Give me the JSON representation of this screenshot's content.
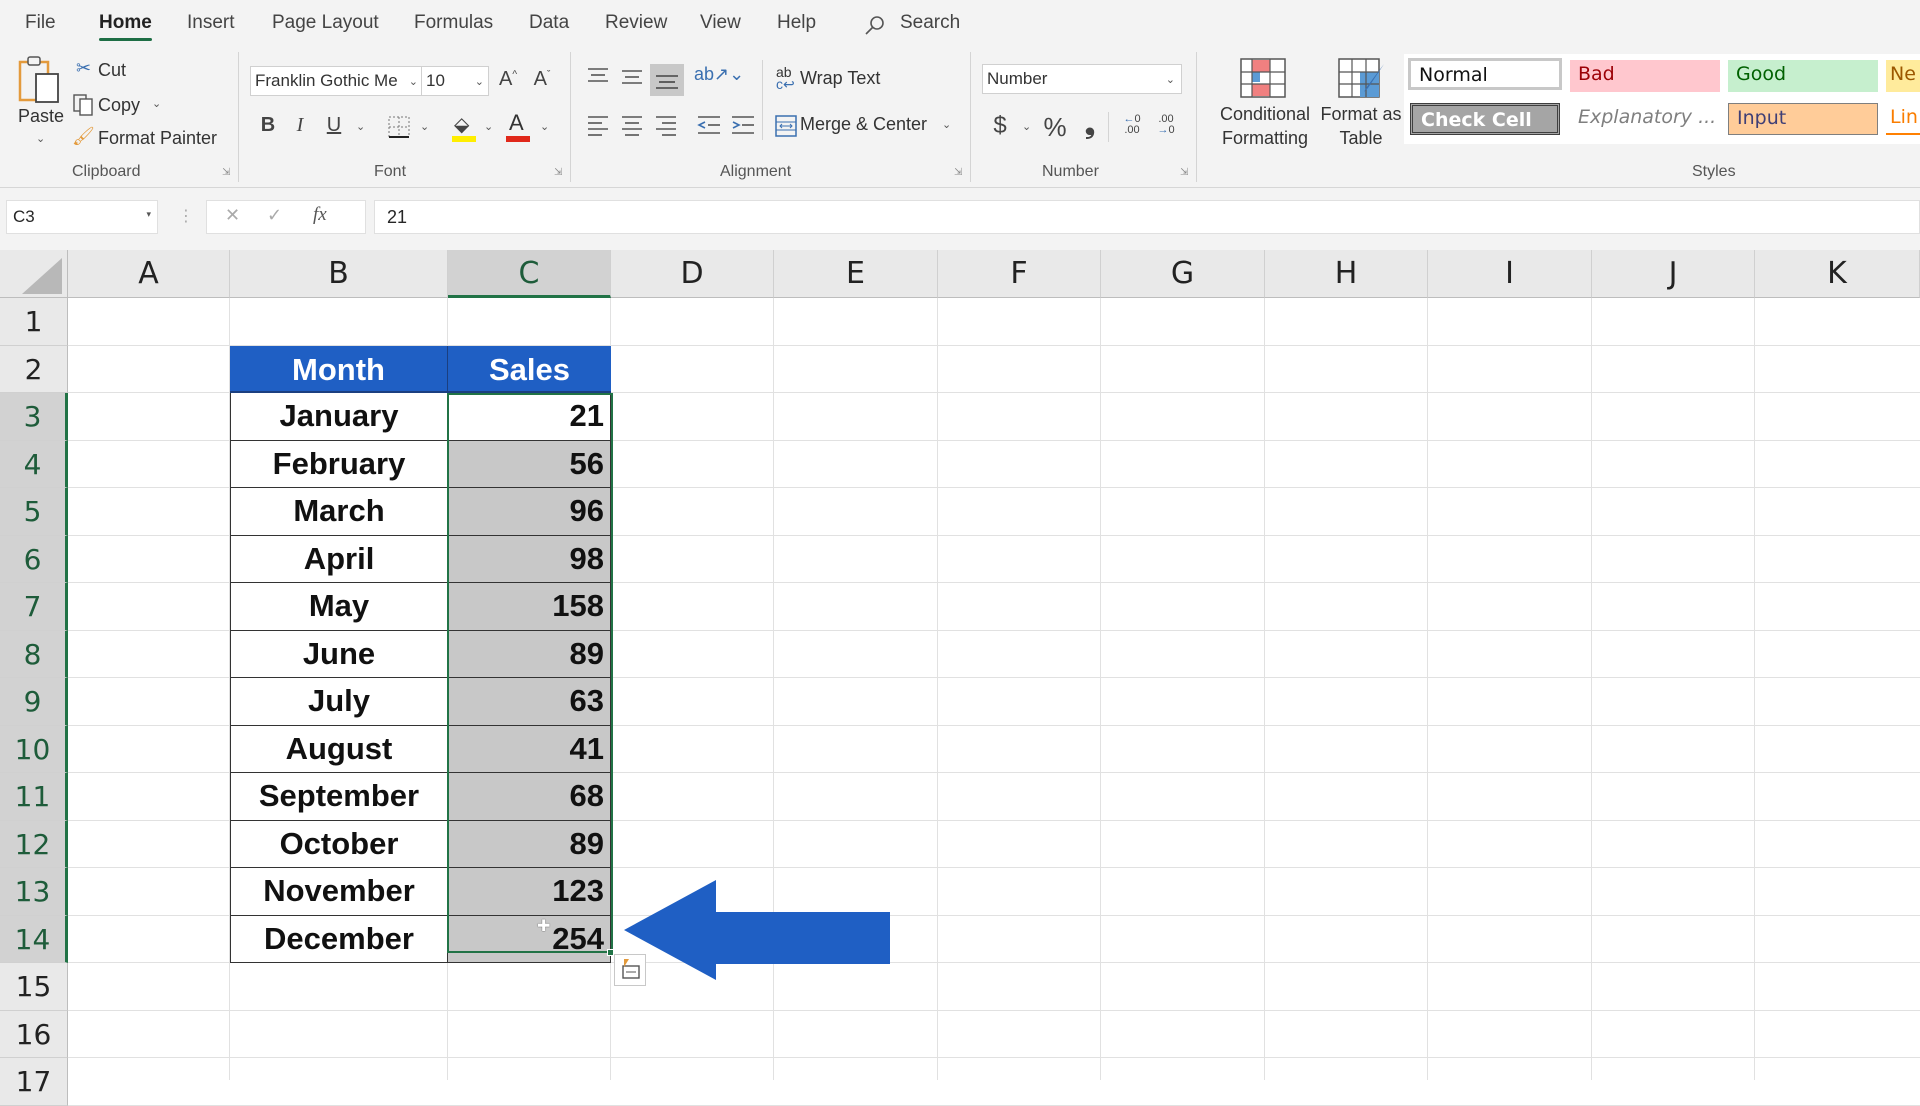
{
  "ribbon": {
    "tabs": [
      {
        "label": "File",
        "active": false
      },
      {
        "label": "Home",
        "active": true
      },
      {
        "label": "Insert",
        "active": false
      },
      {
        "label": "Page Layout",
        "active": false
      },
      {
        "label": "Formulas",
        "active": false
      },
      {
        "label": "Data",
        "active": false
      },
      {
        "label": "Review",
        "active": false
      },
      {
        "label": "View",
        "active": false
      },
      {
        "label": "Help",
        "active": false
      }
    ],
    "search_label": "Search",
    "clipboard": {
      "group_label": "Clipboard",
      "paste": "Paste",
      "cut": "Cut",
      "copy": "Copy",
      "format_painter": "Format Painter"
    },
    "font": {
      "group_label": "Font",
      "font_name": "Franklin Gothic Me",
      "font_size": "10",
      "bold": "B",
      "italic": "I",
      "underline": "U",
      "font_color_glyph": "A",
      "fill_color": "#ffee00",
      "font_color": "#e0281a"
    },
    "alignment": {
      "group_label": "Alignment",
      "wrap_text": "Wrap Text",
      "merge_center": "Merge & Center"
    },
    "number": {
      "group_label": "Number",
      "format": "Number",
      "currency": "$",
      "percent": "%",
      "comma": "9",
      "inc_decimal": "←0 .00",
      "dec_decimal": ".00 →0"
    },
    "styles": {
      "group_label": "Styles",
      "conditional_formatting": [
        "Conditional",
        "Formatting"
      ],
      "format_as_table": [
        "Format as",
        "Table"
      ],
      "cell_styles": [
        {
          "label": "Normal",
          "bg": "#ffffff",
          "fg": "#111111"
        },
        {
          "label": "Bad",
          "bg": "#ffc7ce",
          "fg": "#9c0006"
        },
        {
          "label": "Good",
          "bg": "#c6efce",
          "fg": "#006100"
        },
        {
          "label": "Ne",
          "bg": "#ffeb9c",
          "fg": "#9c5700"
        },
        {
          "label": "Check Cell",
          "bg": "#a5a5a5",
          "fg": "#ffffff"
        },
        {
          "label": "Explanatory ...",
          "bg": "#ffffff",
          "fg": "#7f7f7f"
        },
        {
          "label": "Input",
          "bg": "#ffcc99",
          "fg": "#3f3f76"
        },
        {
          "label": "Lin",
          "bg": "#ffffff",
          "fg": "#fa7d00"
        }
      ]
    }
  },
  "formula_bar": {
    "name_box": "C3",
    "cancel": "✕",
    "enter": "✓",
    "fx": "fx",
    "formula": "21"
  },
  "sheet": {
    "columns": [
      "A",
      "B",
      "C",
      "D",
      "E",
      "F",
      "G",
      "H",
      "I",
      "J",
      "K"
    ],
    "selected_column": "C",
    "rows": [
      "1",
      "2",
      "3",
      "4",
      "5",
      "6",
      "7",
      "8",
      "9",
      "10",
      "11",
      "12",
      "13",
      "14",
      "15",
      "16",
      "17"
    ],
    "selected_rows": [
      "3",
      "4",
      "5",
      "6",
      "7",
      "8",
      "9",
      "10",
      "11",
      "12",
      "13",
      "14"
    ],
    "active_cell": "C3",
    "selection": "C3:C14",
    "table": {
      "header_fill": "#1f5fc4",
      "headers": [
        "Month",
        "Sales"
      ],
      "rows": [
        {
          "month": "January",
          "sales": "21"
        },
        {
          "month": "February",
          "sales": "56"
        },
        {
          "month": "March",
          "sales": "96"
        },
        {
          "month": "April",
          "sales": "98"
        },
        {
          "month": "May",
          "sales": "158"
        },
        {
          "month": "June",
          "sales": "89"
        },
        {
          "month": "July",
          "sales": "63"
        },
        {
          "month": "August",
          "sales": "41"
        },
        {
          "month": "September",
          "sales": "68"
        },
        {
          "month": "October",
          "sales": "89"
        },
        {
          "month": "November",
          "sales": "123"
        },
        {
          "month": "December",
          "sales": "254"
        }
      ]
    },
    "annotation_arrow": {
      "direction": "left",
      "color": "#1f5fc4",
      "points_to": "C14"
    }
  }
}
